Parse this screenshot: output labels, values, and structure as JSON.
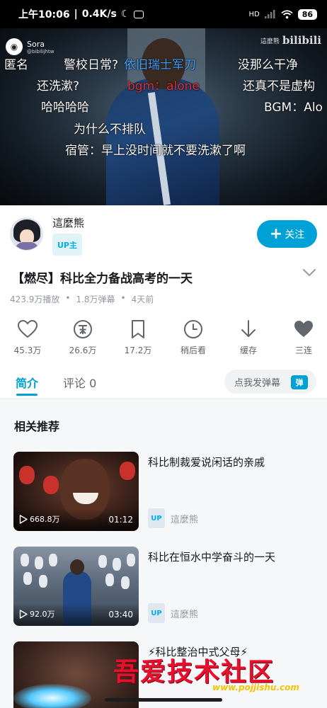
{
  "status_bar": {
    "time": "上午10:06",
    "speed": "0.4K/s",
    "battery": "86"
  },
  "video": {
    "source_name": "Sora",
    "source_handle": "@bibilijhtw",
    "watermark_name": "這麼熊",
    "watermark_brand": "bilibili",
    "danmaku": [
      {
        "text": "匿名",
        "color": "#ffffff"
      },
      {
        "text": "警校日常?",
        "color": "#ffffff"
      },
      {
        "text": "依旧瑞士军刀",
        "color": "#3aa0ff"
      },
      {
        "text": "没那么干净",
        "color": "#ffffff"
      },
      {
        "text": "还洗漱?",
        "color": "#ffffff"
      },
      {
        "text": "bgm：alone",
        "color": "#e2302a"
      },
      {
        "text": "还真不是虚构",
        "color": "#ffffff"
      },
      {
        "text": "哈哈哈哈",
        "color": "#ffffff"
      },
      {
        "text": "BGM：Alo",
        "color": "#ffffff"
      },
      {
        "text": "为什么不排队",
        "color": "#ffffff"
      },
      {
        "text": "宿管：早上没时间就不要洗漱了啊",
        "color": "#ffffff"
      }
    ]
  },
  "uploader": {
    "name": "這麼熊",
    "tag": "UP主",
    "follow_label": "关注",
    "follow_icon": "plus-icon"
  },
  "video_info": {
    "title": "【燃尽】科比全力备战高考的一天",
    "plays": "423.9万播放",
    "danmaku_count": "1.8万弹幕",
    "posted": "4天前"
  },
  "actions": [
    {
      "icon": "heart-icon",
      "label": "45.3万"
    },
    {
      "icon": "coin-icon",
      "label": "26.6万"
    },
    {
      "icon": "bookmark-icon",
      "label": "17.2万"
    },
    {
      "icon": "clock-icon",
      "label": "稍后看"
    },
    {
      "icon": "download-icon",
      "label": "缓存"
    },
    {
      "icon": "triple-heart-icon",
      "label": "三连"
    }
  ],
  "tabs": {
    "intro": "简介",
    "comments": "评论 0",
    "danmaku_placeholder": "点我发弹幕",
    "danmaku_badge": "弹"
  },
  "related": {
    "heading": "相关推荐",
    "items": [
      {
        "title": "科比制裁爱说闲话的亲戚",
        "views": "668.8万",
        "duration": "01:12",
        "up_badge": "UP",
        "up_name": "這麼熊"
      },
      {
        "title": "科比在恒水中学奋斗的一天",
        "views": "92.0万",
        "duration": "03:40",
        "up_badge": "UP",
        "up_name": "這麼熊"
      },
      {
        "title": "⚡科比整治中式父母⚡",
        "views": "",
        "duration": "",
        "up_badge": "",
        "up_name": ""
      }
    ]
  },
  "watermark": {
    "main": "吾爱技术社区",
    "url": "www.pojjishu.com"
  },
  "colors": {
    "accent": "#00a1d6",
    "text_primary": "#18191c",
    "text_secondary": "#9499a0"
  }
}
